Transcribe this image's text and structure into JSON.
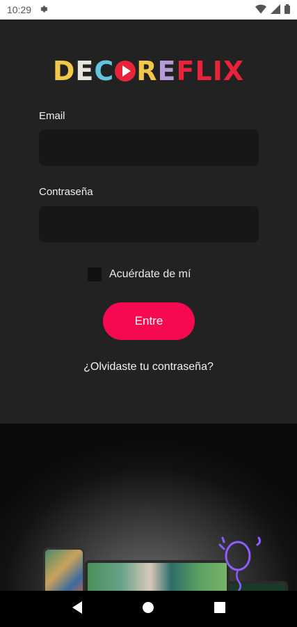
{
  "status_bar": {
    "time": "10:29",
    "icons": [
      "gear-icon",
      "wifi-icon",
      "signal-icon",
      "battery-icon"
    ]
  },
  "logo": {
    "letters": [
      "D",
      "E",
      "C",
      "",
      "R",
      "E",
      "F",
      "L",
      "I",
      "X"
    ],
    "colors": [
      "#f2c84b",
      "#e8e6dc",
      "#63c6de",
      "#e8233a",
      "#f2c84b",
      "#b79ad8",
      "#e8233a",
      "#e8233a",
      "#e8233a",
      "#e8233a"
    ]
  },
  "form": {
    "email_label": "Email",
    "email_value": "",
    "password_label": "Contraseña",
    "password_value": "",
    "remember_label": "Acuérdate de mí",
    "remember_checked": false,
    "submit_label": "Entre",
    "forgot_label": "¿Olvidaste tu contraseña?"
  },
  "colors": {
    "background": "#222222",
    "input_background": "#171717",
    "accent": "#f50a52"
  },
  "nav_bar": {
    "icons": [
      "back-icon",
      "home-icon",
      "recents-icon"
    ]
  }
}
